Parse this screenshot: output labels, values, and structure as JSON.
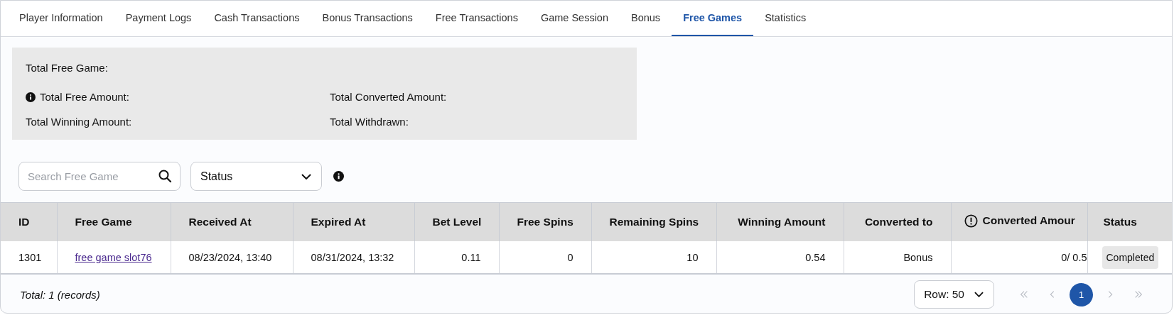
{
  "tabs": [
    {
      "label": "Player Information",
      "selected": false
    },
    {
      "label": "Payment Logs",
      "selected": false
    },
    {
      "label": "Cash Transactions",
      "selected": false
    },
    {
      "label": "Bonus Transactions",
      "selected": false
    },
    {
      "label": "Free Transactions",
      "selected": false
    },
    {
      "label": "Game Session",
      "selected": false
    },
    {
      "label": "Bonus",
      "selected": false
    },
    {
      "label": "Free Games",
      "selected": true
    },
    {
      "label": "Statistics",
      "selected": false
    }
  ],
  "summary": [
    {
      "label": "Total Free Game:",
      "info": false
    },
    {
      "label": "Total Free Amount:",
      "info": true
    },
    {
      "label": "Total Converted Amount:",
      "info": false
    },
    {
      "label": "Total Winning Amount:",
      "info": false
    },
    {
      "label": "Total Withdrawn:",
      "info": false
    }
  ],
  "filters": {
    "search": {
      "placeholder": "Search Free Game"
    },
    "status": {
      "value": "Status"
    }
  },
  "table": {
    "columns": [
      {
        "label": "ID",
        "info": false
      },
      {
        "label": "Free Game",
        "info": false
      },
      {
        "label": "Received At",
        "info": false
      },
      {
        "label": "Expired At",
        "info": false
      },
      {
        "label": "Bet Level",
        "info": false
      },
      {
        "label": "Free Spins",
        "info": false
      },
      {
        "label": "Remaining Spins",
        "info": false
      },
      {
        "label": "Winning Amount",
        "info": false
      },
      {
        "label": "Converted to",
        "info": false
      },
      {
        "label": "Converted Amour",
        "info": true
      },
      {
        "label": "Status",
        "info": false
      }
    ],
    "rows": [
      {
        "cells": [
          {
            "kind": "text",
            "text": "1301"
          },
          {
            "kind": "link",
            "text": "free game slot76"
          },
          {
            "kind": "text",
            "text": "08/23/2024, 13:40"
          },
          {
            "kind": "text",
            "text": "08/31/2024, 13:32"
          },
          {
            "kind": "text",
            "text": "0.11"
          },
          {
            "kind": "text",
            "text": "0"
          },
          {
            "kind": "text",
            "text": "10"
          },
          {
            "kind": "text",
            "text": "0.54"
          },
          {
            "kind": "text",
            "text": "Bonus"
          },
          {
            "kind": "text",
            "text": "0/ 0.5"
          },
          {
            "kind": "badge",
            "text": "Completed"
          }
        ]
      }
    ]
  },
  "footer": {
    "total": "Total: 1 (records)",
    "rows_per_page": "Row: 50",
    "nav": [
      {
        "kind": "first",
        "disabled": true
      },
      {
        "kind": "prev",
        "disabled": true
      },
      {
        "kind": "page",
        "label": "1",
        "selected": true
      },
      {
        "kind": "next",
        "disabled": true
      },
      {
        "kind": "last",
        "disabled": true
      }
    ]
  }
}
